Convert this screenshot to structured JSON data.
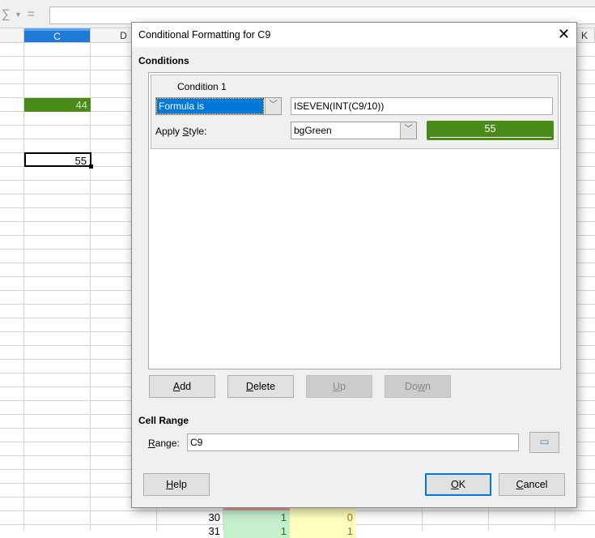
{
  "toolbar": {
    "sum_icon": "sum-icon",
    "equals_icon": "equals-icon",
    "formula_value": ""
  },
  "columns": [
    "C",
    "D",
    "K"
  ],
  "cells": {
    "c4": "44",
    "c8": "55",
    "e30": "30",
    "f30": "1",
    "g30": "0",
    "f31": "1",
    "g31": "1",
    "e31": "31"
  },
  "colors": {
    "green_style": "#4a8a18",
    "light_green": "#c6efce",
    "light_yellow": "#ffffc0",
    "light_red": "#e8a0a0",
    "accent": "#0078d7"
  },
  "dialog": {
    "title": "Conditional Formatting for C9",
    "conditions_heading": "Conditions",
    "condition_label": "Condition 1",
    "condition_type": "Formula is",
    "formula": "ISEVEN(INT(C9/10))",
    "apply_style_label": "Apply Style:",
    "style_value": "bgGreen",
    "preview_text": "55",
    "add": "Add",
    "delete": "Delete",
    "up": "Up",
    "down": "Down",
    "cell_range_heading": "Cell Range",
    "range_label": "Range:",
    "range_value": "C9",
    "help": "Help",
    "ok": "OK",
    "cancel": "Cancel"
  }
}
